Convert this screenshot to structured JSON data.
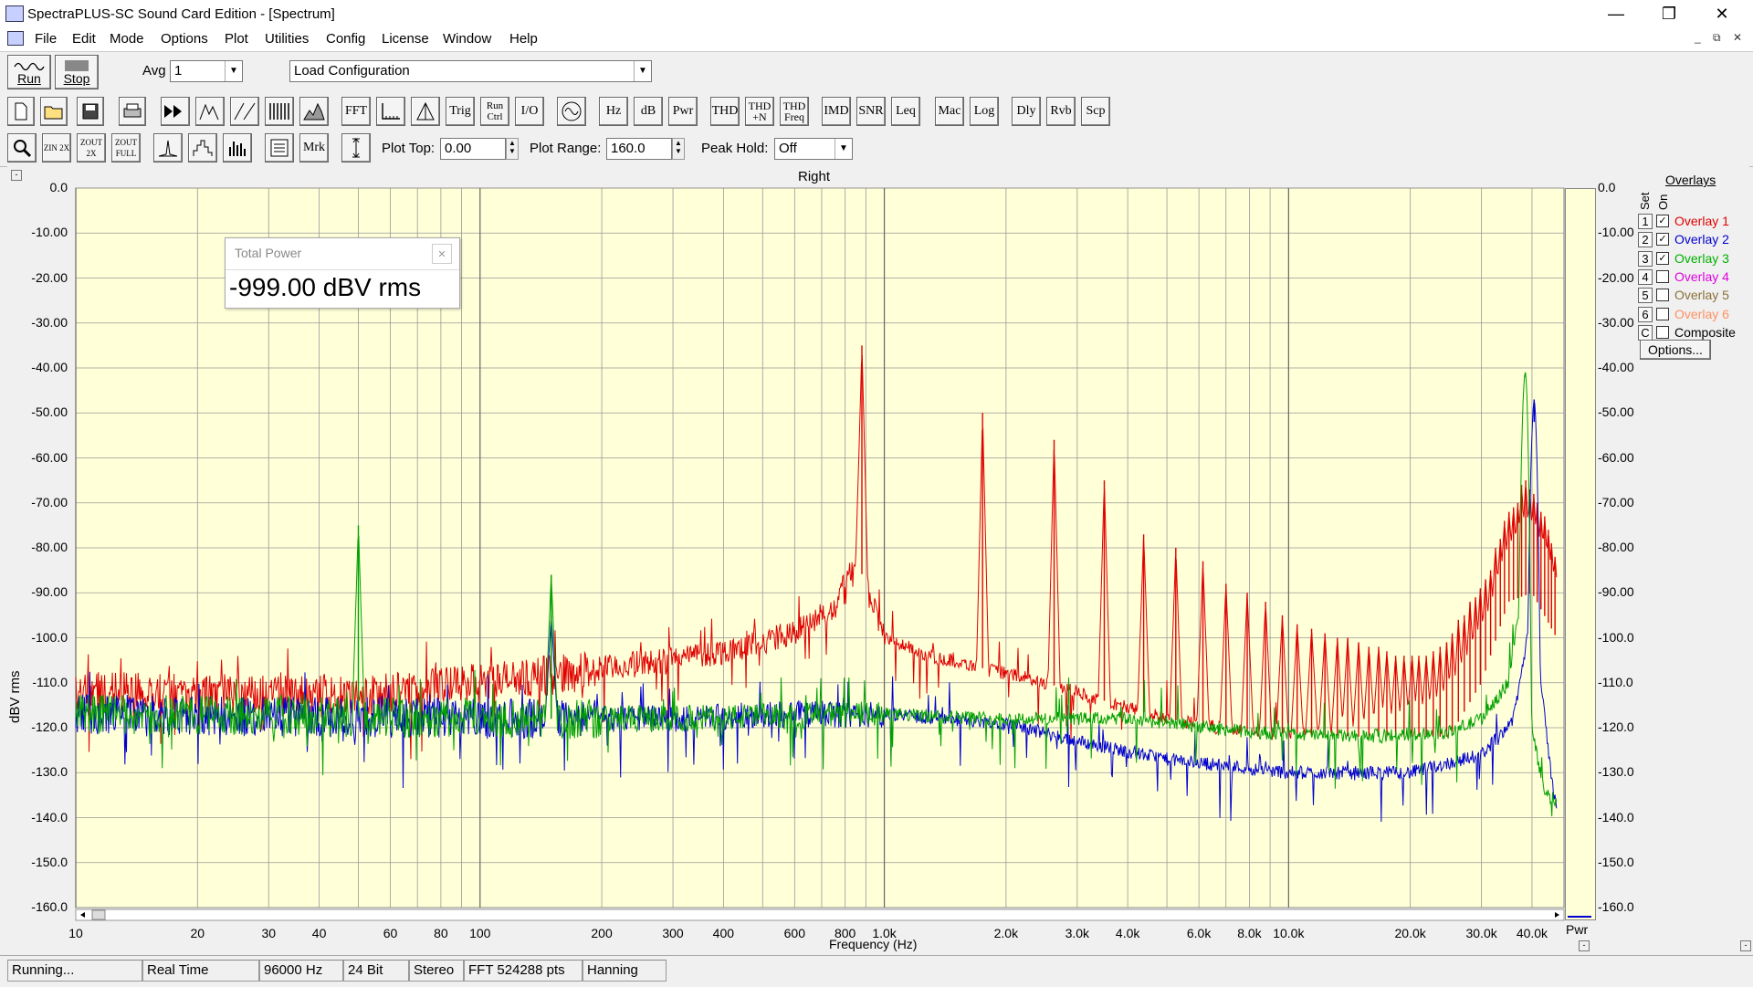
{
  "window": {
    "title": "SpectraPLUS-SC Sound Card Edition - [Spectrum]",
    "minimize": "—",
    "restore": "❐",
    "close": "✕"
  },
  "menu": [
    "File",
    "Edit",
    "Mode",
    "Options",
    "Plot",
    "Utilities",
    "Config",
    "License",
    "Window",
    "Help"
  ],
  "mdi_controls": [
    "_",
    "⧉",
    "✕"
  ],
  "toolbar1": {
    "run_label": "Run",
    "stop_label": "Stop",
    "avg_label": "Avg",
    "avg_value": "1",
    "config_value": "Load Configuration"
  },
  "toolbar2": {
    "buttons": [
      "FFT",
      "Trig",
      "Run Ctrl",
      "I/O",
      "Hz",
      "dB",
      "Pwr",
      "THD",
      "THD +N",
      "THD Freq",
      "IMD",
      "SNR",
      "Leq",
      "Mac",
      "Log",
      "Dly",
      "Rvb",
      "Scp"
    ]
  },
  "toolbar3": {
    "zoom_in": "ZIN 2X",
    "zoom_out": "ZOUT 2X",
    "zoom_full": "ZOUT FULL",
    "mrk": "Mrk",
    "plot_top_label": "Plot Top:",
    "plot_top_value": "0.00",
    "plot_range_label": "Plot Range:",
    "plot_range_value": "160.0",
    "peak_hold_label": "Peak Hold:",
    "peak_hold_value": "Off"
  },
  "chart_data": {
    "type": "line",
    "title": "Right",
    "xlabel": "Frequency (Hz)",
    "ylabel": "dBV rms",
    "xscale": "log",
    "xlim": [
      10,
      48000
    ],
    "ylim": [
      -160,
      0
    ],
    "yticks": [
      "0.0",
      "-10.00",
      "-20.00",
      "-30.00",
      "-40.00",
      "-50.00",
      "-60.00",
      "-70.00",
      "-80.00",
      "-90.00",
      "-100.0",
      "-110.0",
      "-120.0",
      "-130.0",
      "-140.0",
      "-150.0",
      "-160.0"
    ],
    "xticks": [
      {
        "v": 10,
        "label": "10"
      },
      {
        "v": 20,
        "label": "20"
      },
      {
        "v": 30,
        "label": "30"
      },
      {
        "v": 40,
        "label": "40"
      },
      {
        "v": 60,
        "label": "60"
      },
      {
        "v": 80,
        "label": "80"
      },
      {
        "v": 100,
        "label": "100"
      },
      {
        "v": 200,
        "label": "200"
      },
      {
        "v": 300,
        "label": "300"
      },
      {
        "v": 400,
        "label": "400"
      },
      {
        "v": 600,
        "label": "600"
      },
      {
        "v": 800,
        "label": "800"
      },
      {
        "v": 1000,
        "label": "1.0k"
      },
      {
        "v": 2000,
        "label": "2.0k"
      },
      {
        "v": 3000,
        "label": "3.0k"
      },
      {
        "v": 4000,
        "label": "4.0k"
      },
      {
        "v": 6000,
        "label": "6.0k"
      },
      {
        "v": 8000,
        "label": "8.0k"
      },
      {
        "v": 10000,
        "label": "10.0k"
      },
      {
        "v": 20000,
        "label": "20.0k"
      },
      {
        "v": 30000,
        "label": "30.0k"
      },
      {
        "v": 40000,
        "label": "40.0k"
      }
    ],
    "right_axis_unit": "Pwr",
    "background": "#ffffd8",
    "grid": true,
    "series": [
      {
        "name": "Overlay 1",
        "color": "#e00000",
        "baseline": [
          [
            10,
            -112
          ],
          [
            50,
            -113
          ],
          [
            100,
            -110
          ],
          [
            200,
            -107
          ],
          [
            400,
            -103
          ],
          [
            600,
            -99
          ],
          [
            750,
            -93
          ],
          [
            850,
            -82
          ],
          [
            1000,
            -100
          ],
          [
            1300,
            -104
          ],
          [
            1800,
            -107
          ],
          [
            2500,
            -110
          ],
          [
            3500,
            -114
          ],
          [
            5000,
            -118
          ],
          [
            8000,
            -121
          ],
          [
            15000,
            -122
          ],
          [
            25000,
            -122
          ],
          [
            30000,
            -110
          ],
          [
            35000,
            -92
          ],
          [
            40000,
            -90
          ],
          [
            46000,
            -100
          ]
        ],
        "peaks": [
          [
            880,
            -35
          ],
          [
            1750,
            -50
          ],
          [
            2630,
            -56
          ],
          [
            3500,
            -65
          ],
          [
            4380,
            -77
          ],
          [
            5260,
            -80
          ],
          [
            6140,
            -83
          ],
          [
            7000,
            -88
          ],
          [
            7900,
            -90
          ],
          [
            8770,
            -92
          ],
          [
            9650,
            -95
          ],
          [
            10500,
            -97
          ],
          [
            11400,
            -98
          ],
          [
            12300,
            -99
          ],
          [
            13200,
            -100
          ],
          [
            14000,
            -100
          ],
          [
            14900,
            -101
          ],
          [
            15800,
            -102
          ],
          [
            16700,
            -102
          ],
          [
            17500,
            -103
          ],
          [
            18400,
            -104
          ],
          [
            19300,
            -104
          ],
          [
            20200,
            -104
          ],
          [
            21000,
            -104
          ],
          [
            21900,
            -104
          ],
          [
            22800,
            -103
          ],
          [
            23700,
            -102
          ],
          [
            24600,
            -101
          ],
          [
            25400,
            -99
          ],
          [
            26300,
            -96
          ],
          [
            27200,
            -95
          ],
          [
            28100,
            -92
          ],
          [
            29000,
            -91
          ],
          [
            29800,
            -89
          ],
          [
            30700,
            -87
          ],
          [
            31600,
            -85
          ],
          [
            32500,
            -80
          ],
          [
            33400,
            -78
          ],
          [
            34200,
            -74
          ],
          [
            35100,
            -72
          ],
          [
            36000,
            -71
          ],
          [
            36900,
            -70
          ],
          [
            37700,
            -66
          ],
          [
            38600,
            -65
          ],
          [
            39500,
            -67
          ],
          [
            40400,
            -68
          ],
          [
            41200,
            -70
          ],
          [
            42100,
            -72
          ],
          [
            43000,
            -73
          ],
          [
            43900,
            -76
          ],
          [
            44700,
            -79
          ],
          [
            45600,
            -82
          ]
        ]
      },
      {
        "name": "Overlay 2",
        "color": "#0000d0",
        "baseline": [
          [
            10,
            -117
          ],
          [
            100,
            -118
          ],
          [
            300,
            -118
          ],
          [
            600,
            -117
          ],
          [
            1000,
            -117
          ],
          [
            2000,
            -119
          ],
          [
            3000,
            -123
          ],
          [
            5000,
            -127
          ],
          [
            10000,
            -130
          ],
          [
            20000,
            -130
          ],
          [
            30000,
            -126
          ],
          [
            36000,
            -118
          ],
          [
            39000,
            -100
          ],
          [
            40500,
            -52
          ],
          [
            42000,
            -110
          ],
          [
            45000,
            -133
          ],
          [
            46000,
            -137
          ]
        ],
        "peaks": [
          [
            150,
            -95
          ],
          [
            40500,
            -47
          ]
        ]
      },
      {
        "name": "Overlay 3",
        "color": "#00a000",
        "baseline": [
          [
            10,
            -117
          ],
          [
            100,
            -118
          ],
          [
            300,
            -118
          ],
          [
            1000,
            -117
          ],
          [
            2000,
            -118
          ],
          [
            4000,
            -118
          ],
          [
            8000,
            -121
          ],
          [
            15000,
            -122
          ],
          [
            25000,
            -121
          ],
          [
            30000,
            -118
          ],
          [
            35000,
            -110
          ],
          [
            37000,
            -95
          ],
          [
            38500,
            -42
          ],
          [
            40000,
            -120
          ],
          [
            43000,
            -135
          ],
          [
            46000,
            -136
          ]
        ],
        "peaks": [
          [
            50,
            -75
          ],
          [
            150,
            -86
          ],
          [
            38500,
            -41
          ]
        ]
      }
    ]
  },
  "total_power": {
    "title": "Total Power",
    "value": "-999.00 dBV rms",
    "close": "✕"
  },
  "overlays": {
    "title": "Overlays",
    "set_label": "Set",
    "on_label": "On",
    "items": [
      {
        "set": "1",
        "label": "Overlay 1",
        "checked": true,
        "color": "#e00000"
      },
      {
        "set": "2",
        "label": "Overlay 2",
        "checked": true,
        "color": "#0000d0"
      },
      {
        "set": "3",
        "label": "Overlay 3",
        "checked": true,
        "color": "#00b000"
      },
      {
        "set": "4",
        "label": "Overlay 4",
        "checked": false,
        "color": "#e000e0"
      },
      {
        "set": "5",
        "label": "Overlay 5",
        "checked": false,
        "color": "#8a6f3a"
      },
      {
        "set": "6",
        "label": "Overlay 6",
        "checked": false,
        "color": "#ff9060"
      },
      {
        "set": "C",
        "label": "Composite",
        "checked": false,
        "color": "#000000"
      }
    ],
    "options_label": "Options..."
  },
  "status": [
    "Running...",
    "Real Time",
    "96000 Hz",
    "24 Bit",
    "Stereo",
    "FFT 524288 pts",
    "Hanning"
  ]
}
